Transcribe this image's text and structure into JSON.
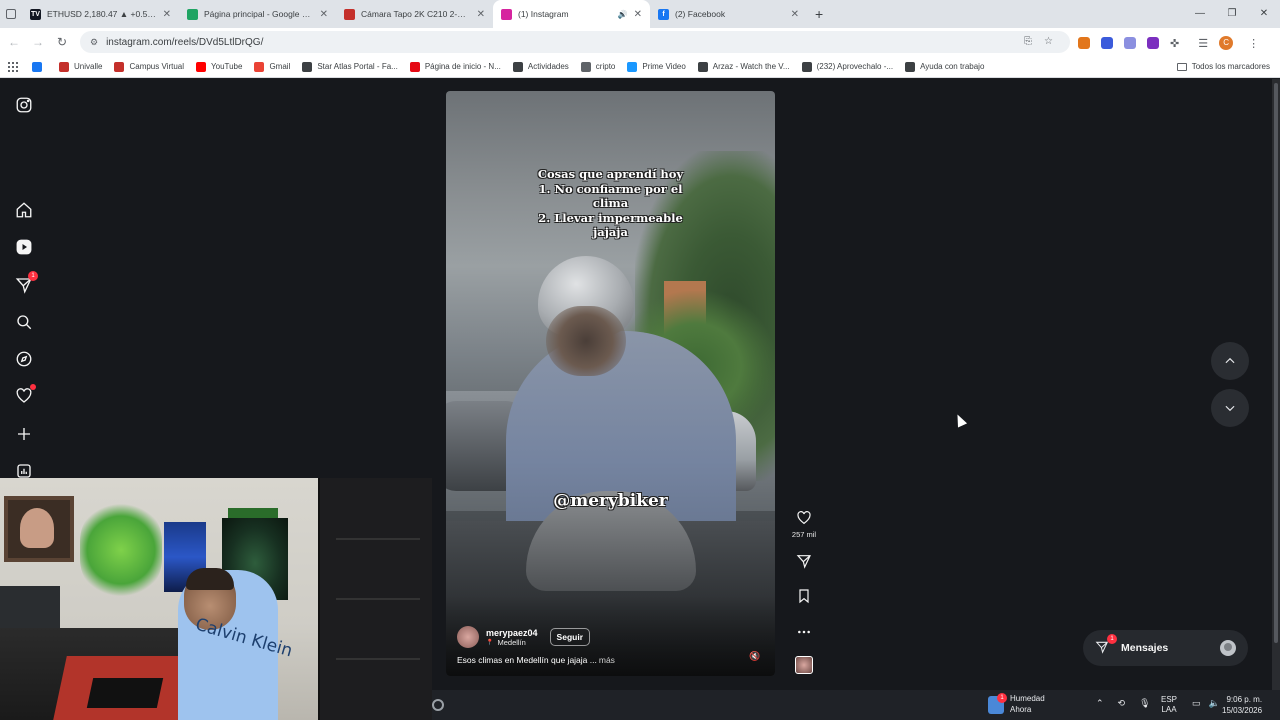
{
  "browser": {
    "tabs": [
      {
        "title": "ETHUSD 2,180.47 ▲ +0.5% Sin",
        "favicon_color": "#131722",
        "favicon_text": "TV",
        "active": false
      },
      {
        "title": "Página principal - Google Drive",
        "favicon_color": "#1fa463",
        "favicon_text": "",
        "active": false
      },
      {
        "title": "Cámara Tapo 2K C210 2-Pack W",
        "favicon_color": "#c4302b",
        "favicon_text": "",
        "active": false
      },
      {
        "title": "(1) Instagram",
        "favicon_color": "#d6249f",
        "favicon_text": "",
        "active": true
      },
      {
        "title": "(2) Facebook",
        "favicon_color": "#1877f2",
        "favicon_text": "f",
        "active": false
      }
    ],
    "url": "instagram.com/reels/DVd5LtlDrQG/",
    "bookmarks": [
      {
        "label": "Univalle",
        "color": "#c4302b"
      },
      {
        "label": "Campus Virtual",
        "color": "#c4302b"
      },
      {
        "label": "YouTube",
        "color": "#ff0000"
      },
      {
        "label": "Gmail",
        "color": "#ea4335"
      },
      {
        "label": "Star Atlas Portal - Fa...",
        "color": "#3c4043"
      },
      {
        "label": "Página de inicio - N...",
        "color": "#e50914"
      },
      {
        "label": "Actividades",
        "color": "#3c4043"
      },
      {
        "label": "cripto",
        "color": "#5f6368"
      },
      {
        "label": "Prime Video",
        "color": "#1a98ff"
      },
      {
        "label": "Arzaz - Watch the V...",
        "color": "#3c4043"
      },
      {
        "label": "(232) Aprovechalo -...",
        "color": "#3c4043"
      },
      {
        "label": "Ayuda con trabajo",
        "color": "#3c4043"
      }
    ],
    "all_bookmarks": "Todos los marcadores",
    "profile_initial": "C"
  },
  "sidenav": {
    "notifications_badge": "1"
  },
  "reel": {
    "overlay_text": [
      "Cosas que aprendí hoy",
      "1. No confiarme por el",
      "clima",
      "2. Llevar impermeable",
      "jajaja"
    ],
    "watermark": "@merybiker",
    "username": "merypaez04",
    "location": "Medellín",
    "follow_label": "Seguir",
    "caption": "Esos climas en Medellín que jajaja ...",
    "more_label": "más",
    "likes": "257 mil"
  },
  "messages": {
    "label": "Mensajes",
    "badge": "1"
  },
  "taskbar": {
    "weather_title": "Humedad",
    "weather_sub": "Ahora",
    "weather_badge": "1",
    "lang_1": "ESP",
    "lang_2": "LAA",
    "time": "9:06 p. m.",
    "date": "15/03/2026"
  },
  "webcam": {
    "shirt_text": "Calvin Klein"
  }
}
